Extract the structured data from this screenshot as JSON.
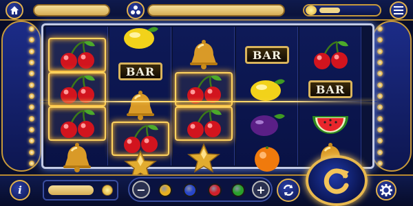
{
  "game": {
    "reels": [
      [
        "cherries",
        "cherries",
        "cherries",
        "bell"
      ],
      [
        "lemon",
        "bar",
        "bell",
        "cherries",
        "star"
      ],
      [
        "bell",
        "cherries",
        "cherries",
        "star"
      ],
      [
        "bar",
        "lemon",
        "plum",
        "orange"
      ],
      [
        "cherries",
        "bar",
        "watermelon",
        "bell"
      ]
    ],
    "bar_label": "BAR",
    "winning_cells": [
      [
        0,
        0
      ],
      [
        0,
        1
      ],
      [
        0,
        2
      ],
      [
        1,
        3
      ],
      [
        2,
        1
      ],
      [
        2,
        2
      ]
    ]
  },
  "controls": {
    "home": "home-icon",
    "menu": "menu-icon",
    "info": "i",
    "minus": "−",
    "plus": "+",
    "chips": [
      {
        "color": "#e8b020"
      },
      {
        "color": "#2846c8"
      },
      {
        "color": "#d0202a"
      },
      {
        "color": "#2aa02a"
      }
    ]
  },
  "colors": {
    "gold": "#e2b24c",
    "navy": "#0b1238",
    "win_glow": "#ffd460"
  }
}
